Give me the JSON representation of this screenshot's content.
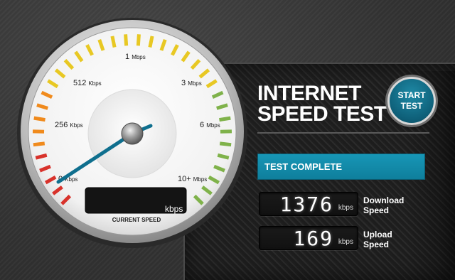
{
  "app": {
    "title_line1": "INTERNET",
    "title_line2": "SPEED TEST"
  },
  "start_button": {
    "line1": "START",
    "line2": "TEST"
  },
  "status": {
    "text": "TEST COMPLETE"
  },
  "gauge": {
    "scale_labels": [
      {
        "value": "0",
        "unit": "Kbps"
      },
      {
        "value": "256",
        "unit": "Kbps"
      },
      {
        "value": "512",
        "unit": "Kbps"
      },
      {
        "value": "1",
        "unit": "Mbps"
      },
      {
        "value": "3",
        "unit": "Mbps"
      },
      {
        "value": "6",
        "unit": "Mbps"
      },
      {
        "value": "10+",
        "unit": "Mbps"
      }
    ],
    "current_speed_value": "",
    "current_speed_unit": "kbps",
    "current_speed_label": "CURRENT SPEED",
    "needle_level": 0.0,
    "tick_colors": {
      "red": "#d8322b",
      "orange": "#f08a1c",
      "yellow": "#e8c823",
      "green": "#7fb24a"
    },
    "needle_color": "#0f6f8e"
  },
  "download": {
    "value": "1376",
    "unit": "kbps",
    "label_line1": "Download",
    "label_line2": "Speed"
  },
  "upload": {
    "value": "169",
    "unit": "kbps",
    "label_line1": "Upload",
    "label_line2": "Speed"
  }
}
